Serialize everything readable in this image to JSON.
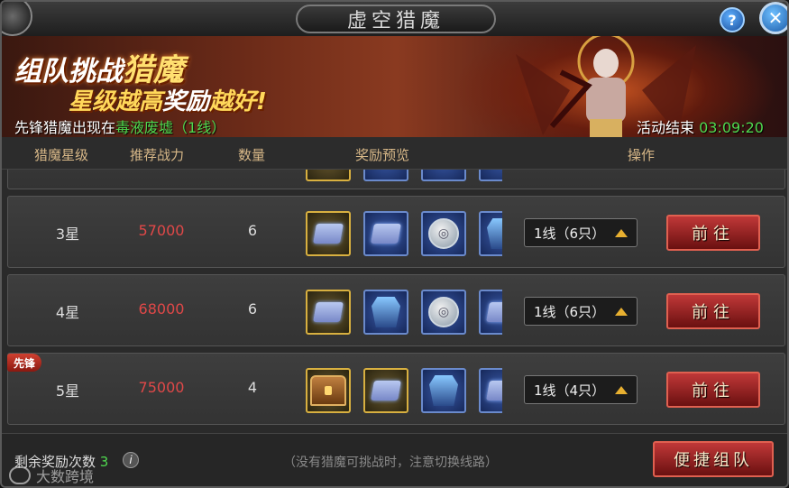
{
  "window": {
    "title": "虚空猎魔",
    "help_label": "?",
    "close_label": "✕"
  },
  "banner": {
    "line1_a": "组队挑战",
    "line1_b": "猎魔",
    "line2_a": "星级越高",
    "line2_b": "奖励",
    "line2_c": "越好!",
    "vanguard_prefix": "先锋猎魔出现在",
    "vanguard_location": "毒液废墟（1线）",
    "event_end_label": "活动结束",
    "event_end_time": "03:09:20"
  },
  "table": {
    "headers": {
      "star": "猎魔星级",
      "power": "推荐战力",
      "qty": "数量",
      "rewards": "奖励预览",
      "action": "操作"
    },
    "rows": [
      {
        "star": "3星",
        "power": "57000",
        "qty": "6",
        "rewards": [
          "scroll-gold-icon",
          "scroll-blue-icon",
          "silver-coin-icon",
          "armor-icon"
        ],
        "line": "1线（6只）",
        "go": "前往"
      },
      {
        "star": "4星",
        "power": "68000",
        "qty": "6",
        "rewards": [
          "scroll-gold-icon",
          "armor-icon",
          "silver-coin-icon",
          "scroll-blue-icon"
        ],
        "line": "1线（6只）",
        "go": "前往"
      },
      {
        "star": "5星",
        "power": "75000",
        "qty": "4",
        "tag": "先锋",
        "rewards": [
          "treasure-chest-icon",
          "scroll-gold-icon",
          "armor-icon",
          "scroll-blue-icon"
        ],
        "line": "1线（4只）",
        "go": "前往"
      }
    ]
  },
  "footer": {
    "remaining_label": "剩余奖励次数",
    "remaining_count": "3",
    "info_label": "i",
    "hint": "（没有猎魔可挑战时，注意切换线路）",
    "quick_team": "便捷组队",
    "watermark": "大数跨境"
  },
  "colors": {
    "power_red": "#e04848",
    "highlight_green": "#4fd84f",
    "button_red": "#a02020"
  }
}
